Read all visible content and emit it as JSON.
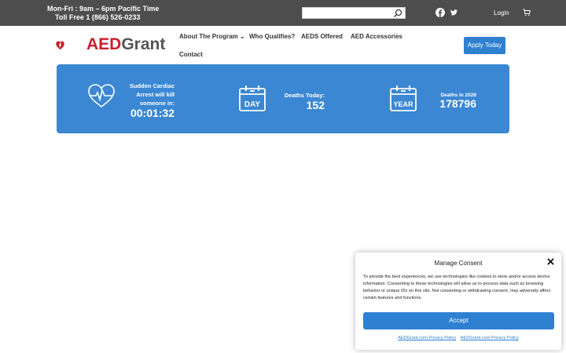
{
  "topbar": {
    "hours_line1": "Mon-Fri : 9am – 6pm Pacific Time",
    "hours_line2": "Toll Free 1 (866) 526-0233",
    "search_placeholder": "",
    "login_label": "Login",
    "icons": [
      "search-icon",
      "facebook-icon",
      "twitter-icon",
      "cart-icon"
    ]
  },
  "header": {
    "logo_part1": "AED",
    "logo_part2": "Grant",
    "nav": [
      {
        "label": "About The Program ⌄"
      },
      {
        "label": "Who Qualifies?"
      },
      {
        "label": "AEDS Offered"
      },
      {
        "label": "AED Accessories"
      },
      {
        "label": "Contact"
      }
    ],
    "apply_label": "Apply Today"
  },
  "panel": {
    "arrest_label": "Sudden Cardiac Arrest will kill someone in:",
    "arrest_timer": "00:01:32",
    "day_icon_label": "DAY",
    "today_label": "Deaths Today:",
    "today_value": "152",
    "year_icon_label": "YEAR",
    "year_label": "Deaths in 2026",
    "year_value": "178796",
    "colors": {
      "panel": "#3b87d3"
    }
  },
  "consent": {
    "title": "Manage Consent",
    "body": "To provide the best experiences, we use technologies like cookies to store and/or access device information. Consenting to these technologies will allow us to process data such as browsing behavior or unique IDs on this site. Not consenting or withdrawing consent, may adversely affect certain features and functions.",
    "accept_label": "Accept",
    "link1": "AEDGrant.com Privacy Policy",
    "link2": "AEDGrant.com Privacy Policy"
  }
}
